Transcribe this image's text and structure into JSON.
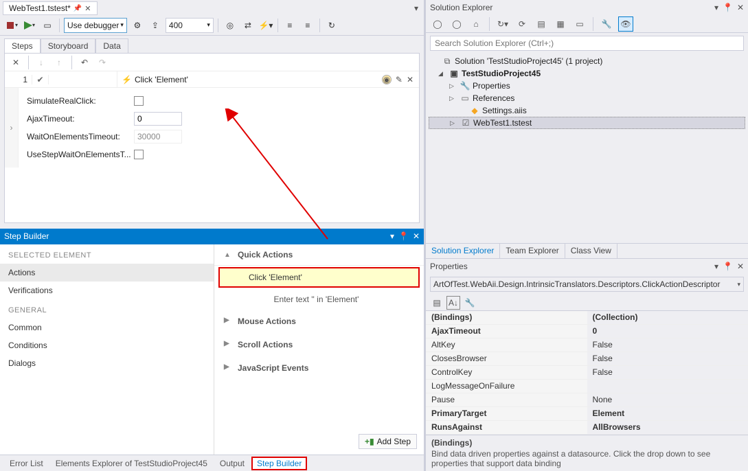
{
  "openDoc": {
    "name": "WebTest1.tstest*"
  },
  "toolbar": {
    "debuggerCombo": "Use debugger",
    "sizeValue": "400"
  },
  "subTabs": {
    "steps": "Steps",
    "storyboard": "Storyboard",
    "data": "Data"
  },
  "step": {
    "index": "1",
    "title": "Click 'Element'",
    "props": {
      "simulateRealClick": "SimulateRealClick:",
      "ajaxTimeoutLabel": "AjaxTimeout:",
      "ajaxTimeoutValue": "0",
      "waitOnElementsLabel": "WaitOnElementsTimeout:",
      "waitOnElementsValue": "30000",
      "useStepWaitLabel": "UseStepWaitOnElementsT..."
    }
  },
  "stepBuilder": {
    "title": "Step Builder",
    "selectedHeader": "SELECTED ELEMENT",
    "generalHeader": "GENERAL",
    "left": {
      "actions": "Actions",
      "verifications": "Verifications",
      "common": "Common",
      "conditions": "Conditions",
      "dialogs": "Dialogs"
    },
    "quickActions": "Quick Actions",
    "clickElement": "Click 'Element'",
    "enterText": "Enter text '' in 'Element'",
    "mouseActions": "Mouse Actions",
    "scrollActions": "Scroll Actions",
    "jsEvents": "JavaScript Events",
    "addStep": "Add Step"
  },
  "bottomTabs": {
    "errorList": "Error List",
    "elementsExplorer": "Elements Explorer of TestStudioProject45",
    "output": "Output",
    "stepBuilder": "Step Builder"
  },
  "solutionExplorer": {
    "title": "Solution Explorer",
    "searchPlaceholder": "Search Solution Explorer (Ctrl+;)",
    "solution": "Solution 'TestStudioProject45' (1 project)",
    "project": "TestStudioProject45",
    "properties": "Properties",
    "references": "References",
    "settings": "Settings.aiis",
    "webtest": "WebTest1.tstest",
    "tabs": {
      "se": "Solution Explorer",
      "te": "Team Explorer",
      "cv": "Class View"
    }
  },
  "propertiesPanel": {
    "title": "Properties",
    "descriptor": "ArtOfTest.WebAii.Design.IntrinsicTranslators.Descriptors.ClickActionDescriptor",
    "rows": {
      "bindings": {
        "name": "(Bindings)",
        "value": "(Collection)"
      },
      "ajaxTimeout": {
        "name": "AjaxTimeout",
        "value": "0"
      },
      "altKey": {
        "name": "AltKey",
        "value": "False"
      },
      "closesBrowser": {
        "name": "ClosesBrowser",
        "value": "False"
      },
      "controlKey": {
        "name": "ControlKey",
        "value": "False"
      },
      "logMsg": {
        "name": "LogMessageOnFailure",
        "value": ""
      },
      "pause": {
        "name": "Pause",
        "value": "None"
      },
      "primaryTarget": {
        "name": "PrimaryTarget",
        "value": "Element"
      },
      "runsAgainst": {
        "name": "RunsAgainst",
        "value": "AllBrowsers"
      }
    },
    "desc": {
      "title": "(Bindings)",
      "text": "Bind data driven properties against a datasource. Click the drop down to see properties that support data binding"
    }
  }
}
